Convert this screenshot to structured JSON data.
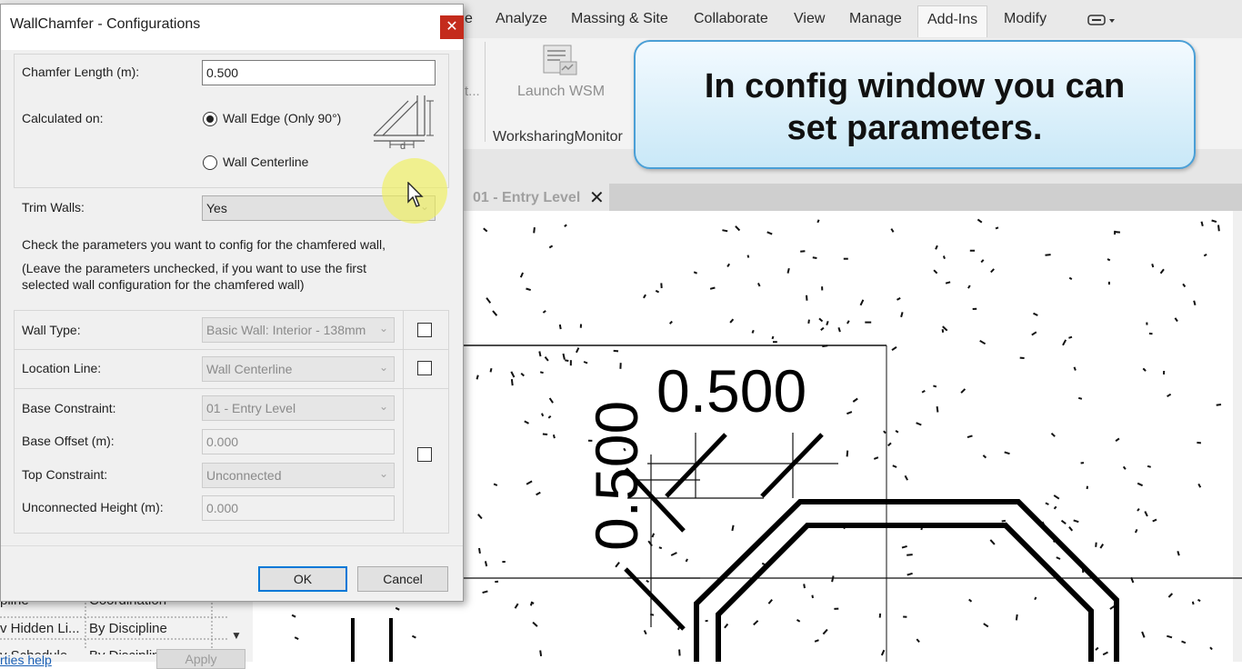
{
  "ribbon": {
    "tabs": [
      {
        "label": "e"
      },
      {
        "label": "Analyze"
      },
      {
        "label": "Massing & Site"
      },
      {
        "label": "Collaborate"
      },
      {
        "label": "View"
      },
      {
        "label": "Manage"
      },
      {
        "label": "Add-Ins"
      },
      {
        "label": "Modify"
      }
    ],
    "cut_label": "t...",
    "launch_label": "Launch WSM",
    "panel_name": "WorksharingMonitor"
  },
  "view_tab": {
    "label": "01 - Entry Level",
    "close": "✕"
  },
  "callout": {
    "line1": "In config window you can",
    "line2": "set parameters."
  },
  "drawing": {
    "dim_horizontal": "0.500",
    "dim_vertical": "0.500"
  },
  "properties": {
    "row1_left": "pline",
    "row1_right": "Coordination",
    "row2_left": "v Hidden Li...",
    "row2_right": "By Discipline",
    "row3_left": "v Schedule...",
    "row3_right": "By Discipline",
    "help_link": "rties help",
    "apply": "Apply"
  },
  "dialog": {
    "title": "WallChamfer - Configurations",
    "close": "✕",
    "chamfer_length_label": "Chamfer Length (m):",
    "chamfer_length_value": "0.500",
    "calculated_on_label": "Calculated on:",
    "option_wall_edge": "Wall Edge (Only 90°)",
    "option_wall_centerline": "Wall Centerline",
    "diagram_label": "d",
    "trim_walls_label": "Trim Walls:",
    "trim_walls_value": "Yes",
    "instruction_1": "Check the parameters you want to config for the chamfered wall,",
    "instruction_2a": "(Leave the parameters unchecked, if you want to use the first",
    "instruction_2b": "selected wall configuration for the chamfered wall)",
    "wall_type_label": "Wall Type:",
    "wall_type_value": "Basic Wall: Interior - 138mm",
    "location_line_label": "Location Line:",
    "location_line_value": "Wall Centerline",
    "base_constraint_label": "Base Constraint:",
    "base_constraint_value": "01 - Entry Level",
    "base_offset_label": "Base Offset (m):",
    "base_offset_value": "0.000",
    "top_constraint_label": "Top Constraint:",
    "top_constraint_value": "Unconnected",
    "unconnected_height_label": "Unconnected Height (m):",
    "unconnected_height_value": "0.000",
    "ok": "OK",
    "cancel": "Cancel",
    "checkboxes": {
      "wall_type": false,
      "location_line": false,
      "constraints": false
    },
    "selected_option": "wall_edge"
  }
}
